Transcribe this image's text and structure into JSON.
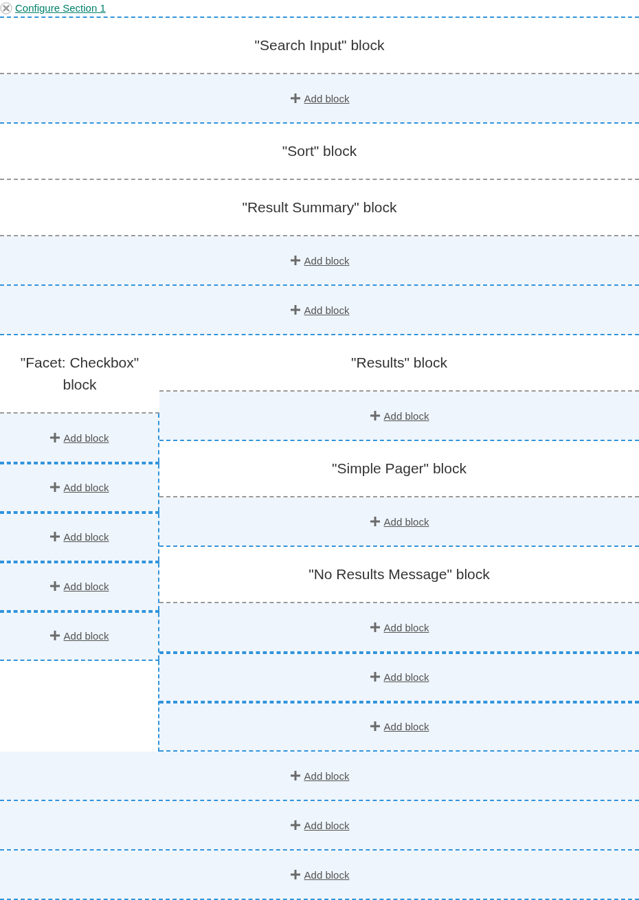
{
  "section_link": {
    "label": "Configure Section 1"
  },
  "sections": [
    {
      "kind": "one_column",
      "regions": [
        {
          "items": [
            {
              "kind": "block",
              "label": "\"Search Input\" block"
            },
            {
              "kind": "add",
              "label": "Add block"
            }
          ]
        },
        {
          "items": [
            {
              "kind": "block",
              "label": "\"Sort\" block"
            },
            {
              "kind": "block",
              "label": "\"Result Summary\" block"
            },
            {
              "kind": "add",
              "label": "Add block"
            }
          ]
        },
        {
          "items": [
            {
              "kind": "add",
              "label": "Add block"
            }
          ]
        }
      ]
    },
    {
      "kind": "two_column",
      "columns": [
        {
          "regions": [
            {
              "items": [
                {
                  "kind": "block",
                  "label": "\"Facet: Checkbox\" block"
                },
                {
                  "kind": "add",
                  "label": "Add block"
                }
              ]
            },
            {
              "items": [
                {
                  "kind": "add",
                  "label": "Add block"
                }
              ]
            },
            {
              "items": [
                {
                  "kind": "add",
                  "label": "Add block"
                }
              ]
            },
            {
              "items": [
                {
                  "kind": "add",
                  "label": "Add block"
                }
              ]
            },
            {
              "items": [
                {
                  "kind": "add",
                  "label": "Add block"
                }
              ]
            }
          ]
        },
        {
          "regions": [
            {
              "items": [
                {
                  "kind": "block",
                  "label": "\"Results\" block"
                },
                {
                  "kind": "add",
                  "label": "Add block"
                }
              ]
            },
            {
              "items": [
                {
                  "kind": "block",
                  "label": "\"Simple Pager\" block"
                },
                {
                  "kind": "add",
                  "label": "Add block"
                }
              ]
            },
            {
              "items": [
                {
                  "kind": "block",
                  "label": "\"No Results Message\" block"
                },
                {
                  "kind": "add",
                  "label": "Add block"
                }
              ]
            },
            {
              "items": [
                {
                  "kind": "add",
                  "label": "Add block"
                }
              ]
            },
            {
              "items": [
                {
                  "kind": "add",
                  "label": "Add block"
                }
              ]
            }
          ]
        }
      ]
    },
    {
      "kind": "one_column",
      "regions": [
        {
          "items": [
            {
              "kind": "add",
              "label": "Add block"
            }
          ]
        },
        {
          "items": [
            {
              "kind": "add",
              "label": "Add block"
            }
          ]
        },
        {
          "items": [
            {
              "kind": "add",
              "label": "Add block"
            }
          ]
        }
      ]
    }
  ]
}
